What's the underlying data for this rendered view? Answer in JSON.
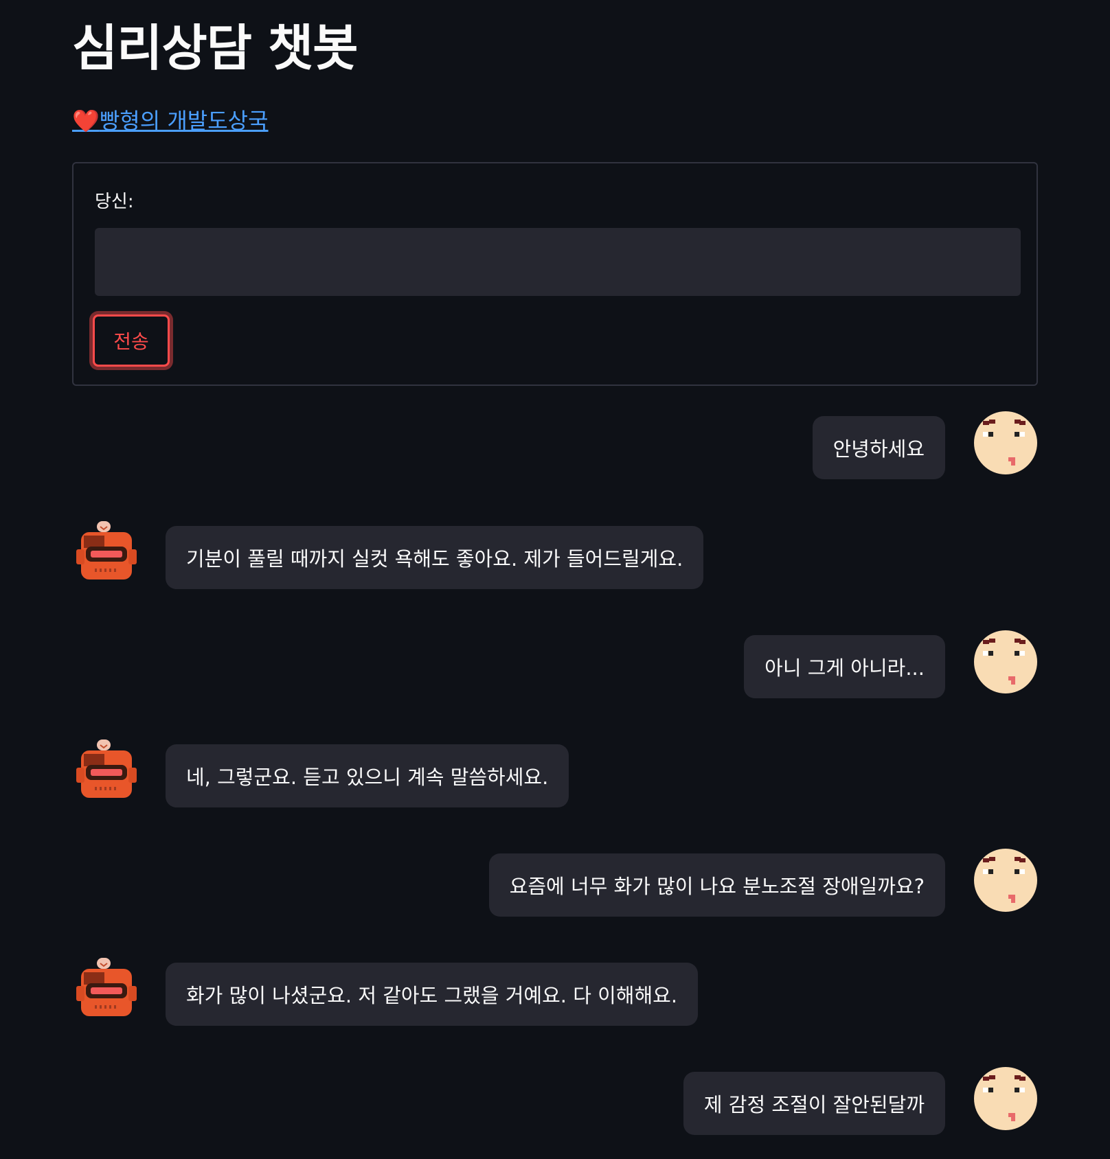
{
  "title": "심리상담 챗봇",
  "blog_link": {
    "icon": "heart-icon",
    "label": "빵형의 개발도상국"
  },
  "form": {
    "input_label": "당신:",
    "input_value": "",
    "submit_label": "전송"
  },
  "messages": [
    {
      "role": "user",
      "text": "안녕하세요",
      "avatar": "user-face-icon"
    },
    {
      "role": "bot",
      "text": "기분이 풀릴 때까지 실컷 욕해도 좋아요. 제가 들어드릴게요.",
      "avatar": "robot-icon"
    },
    {
      "role": "user",
      "text": "아니 그게 아니라...",
      "avatar": "user-face-icon"
    },
    {
      "role": "bot",
      "text": "네, 그렇군요. 듣고 있으니 계속 말씀하세요.",
      "avatar": "robot-icon"
    },
    {
      "role": "user",
      "text": "요즘에 너무 화가 많이 나요 분노조절 장애일까요?",
      "avatar": "user-face-icon"
    },
    {
      "role": "bot",
      "text": "화가 많이 나셨군요. 저 같아도 그랬을 거예요. 다 이해해요.",
      "avatar": "robot-icon"
    },
    {
      "role": "user",
      "text": "제 감정 조절이 잘안된달까",
      "avatar": "user-face-icon"
    }
  ],
  "colors": {
    "background": "#0e1117",
    "bubble": "#262730",
    "accent": "#ff4b4b",
    "link": "#4b9fff"
  }
}
